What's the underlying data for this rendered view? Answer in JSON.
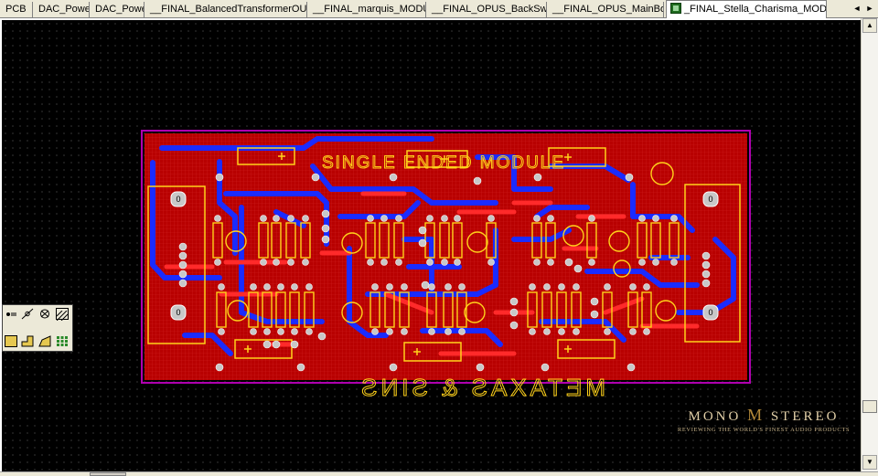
{
  "tabs": [
    {
      "label": "PCB"
    },
    {
      "label": "DAC_Power"
    },
    {
      "label": "DAC_Power"
    },
    {
      "label": "__FINAL_BalancedTransformerOUTPUT"
    },
    {
      "label": "__FINAL_marquis_MODULE"
    },
    {
      "label": "__FINAL_OPUS_BackSwitch"
    },
    {
      "label": "__FINAL_OPUS_MainBoard"
    },
    {
      "label": "_FINAL_Stella_Charisma_MODULE",
      "active": true,
      "icon": "pcb-document-icon"
    }
  ],
  "tab_nav": {
    "prev": "◄",
    "next": "►"
  },
  "scrollbar": {
    "up": "▲",
    "down": "▼"
  },
  "board": {
    "top_silk_text": "SINGLE ENDED MODULE",
    "bottom_silk_text": "METAXAS & SINS",
    "pad_mark": "0",
    "colors": {
      "board_fill": "#c80000",
      "top_copper": "#ff2a2a",
      "bottom_copper": "#1a2bff",
      "silkscreen": "#ffd21a",
      "pads": "#c8c8c8",
      "outline": "#b000b0"
    }
  },
  "toolbox": {
    "tools": [
      {
        "icon": "place-pad-icon"
      },
      {
        "icon": "place-via-icon"
      },
      {
        "icon": "no-connect-icon"
      },
      {
        "icon": "hatch-fill-icon"
      },
      {
        "icon": "place-square-icon"
      },
      {
        "icon": "place-polygon-icon"
      },
      {
        "icon": "place-shape-icon"
      },
      {
        "icon": "pad-array-icon"
      }
    ]
  },
  "watermark": {
    "logo_left": "MONO",
    "logo_mark": "M",
    "logo_right": "STEREO",
    "tagline": "REVIEWING THE WORLD'S FINEST AUDIO PRODUCTS"
  }
}
